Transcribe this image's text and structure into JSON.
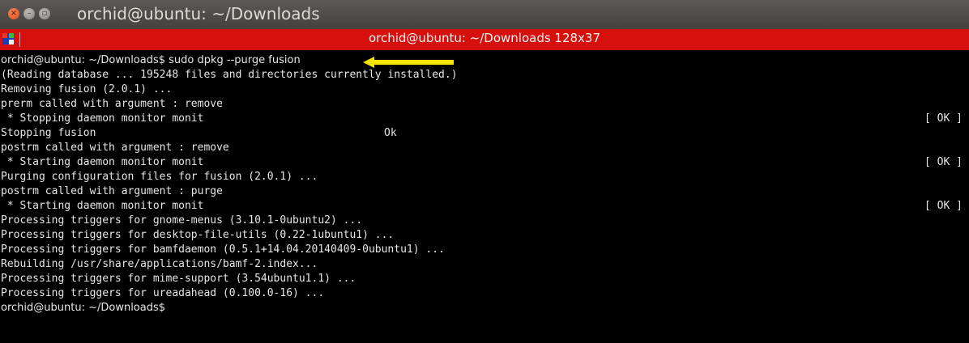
{
  "window": {
    "title": "orchid@ubuntu: ~/Downloads",
    "close_glyph": "×",
    "min_glyph": "–",
    "max_glyph": "▫"
  },
  "tab": {
    "title": "orchid@ubuntu: ~/Downloads 128x37"
  },
  "terminal": {
    "lines": [
      "orchid@ubuntu: ~/Downloads$ sudo dpkg --purge fusion",
      "(Reading database ... 195248 files and directories currently installed.)",
      "Removing fusion (2.0.1) ...",
      "prerm called with argument : remove",
      " * Stopping daemon monitor monit",
      "Stopping fusion",
      "postrm called with argument : remove",
      " * Starting daemon monitor monit",
      "Purging configuration files for fusion (2.0.1) ...",
      "postrm called with argument : purge",
      " * Starting daemon monitor monit",
      "Processing triggers for gnome-menus (3.10.1-0ubuntu2) ...",
      "Processing triggers for desktop-file-utils (0.22-1ubuntu1) ...",
      "Processing triggers for bamfdaemon (0.5.1+14.04.20140409-0ubuntu1) ...",
      "Rebuilding /usr/share/applications/bamf-2.index...",
      "Processing triggers for mime-support (3.54ubuntu1.1) ...",
      "Processing triggers for ureadahead (0.100.0-16) ...",
      "orchid@ubuntu: ~/Downloads$"
    ],
    "status_ok": "[ OK ]",
    "fusion_stop_status": "Ok"
  },
  "colors": {
    "tab_bar": "#d5100d",
    "arrow": "#f5e400"
  }
}
